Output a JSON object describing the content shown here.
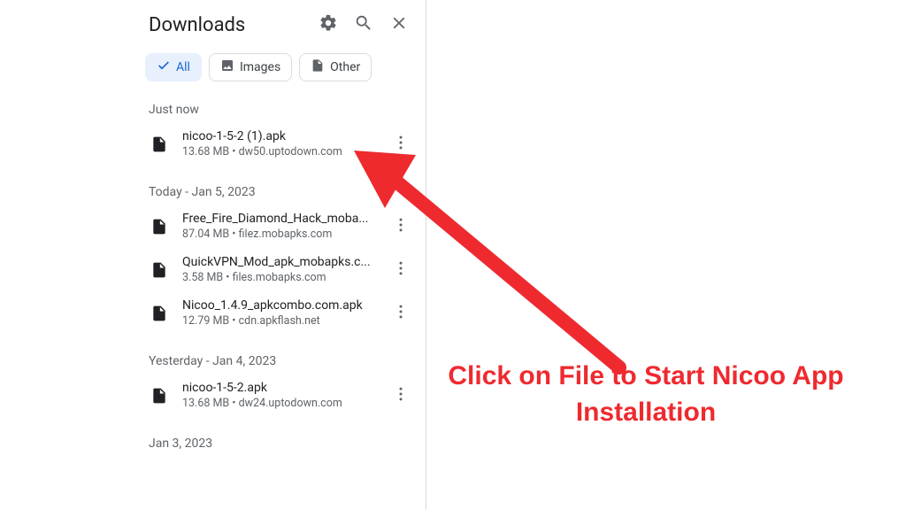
{
  "header": {
    "title": "Downloads"
  },
  "chips": {
    "all": {
      "label": "All"
    },
    "images": {
      "label": "Images"
    },
    "other": {
      "label": "Other"
    }
  },
  "sections": [
    {
      "header": "Just now",
      "items": [
        {
          "name": "nicoo-1-5-2 (1).apk",
          "meta": "13.68 MB • dw50.uptodown.com"
        }
      ]
    },
    {
      "header": "Today - Jan 5, 2023",
      "items": [
        {
          "name": "Free_Fire_Diamond_Hack_moba...",
          "meta": "87.04 MB • filez.mobapks.com"
        },
        {
          "name": "QuickVPN_Mod_apk_mobapks.c...",
          "meta": "3.58 MB • files.mobapks.com"
        },
        {
          "name": "Nicoo_1.4.9_apkcombo.com.apk",
          "meta": "12.79 MB • cdn.apkflash.net"
        }
      ]
    },
    {
      "header": "Yesterday - Jan 4, 2023",
      "items": [
        {
          "name": "nicoo-1-5-2.apk",
          "meta": "13.68 MB • dw24.uptodown.com"
        }
      ]
    },
    {
      "header": "Jan 3, 2023",
      "items": []
    }
  ],
  "annotation": {
    "text": "Click on File to Start Nicoo App Installation"
  },
  "colors": {
    "accent_red": "#ee2a2f",
    "chip_active_bg": "#e8f0fe",
    "chip_active_fg": "#1967d2"
  }
}
